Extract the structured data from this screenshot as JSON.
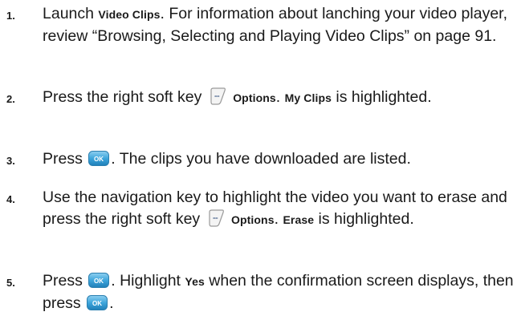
{
  "steps": [
    {
      "number": "1.",
      "parts": [
        "Launch ",
        "Video Clips",
        ". For information about lanching your video player, review “Browsing, Selecting and Playing Video Clips” on page 91."
      ]
    },
    {
      "number": "2.",
      "parts": [
        "Press the right soft key ",
        "Options",
        ". ",
        "My Clips",
        " is highlighted."
      ]
    },
    {
      "number": "3.",
      "parts": [
        "Press ",
        ". The clips you have downloaded are listed."
      ]
    },
    {
      "number": "4.",
      "parts": [
        "Use the navigation key to highlight the video you want to erase and press the right soft key ",
        "Options",
        ". ",
        "Erase",
        " is highlighted."
      ]
    },
    {
      "number": "5.",
      "parts": [
        "Press ",
        ". Highlight ",
        "Yes",
        " when the confirmation screen displays, then press ",
        "."
      ]
    }
  ],
  "icons": {
    "soft_key": "right-soft-key-icon",
    "ok_key": "ok-key-icon"
  },
  "colors": {
    "text": "#1a1a1a",
    "ok_key_fill": "#3ea6dc"
  }
}
